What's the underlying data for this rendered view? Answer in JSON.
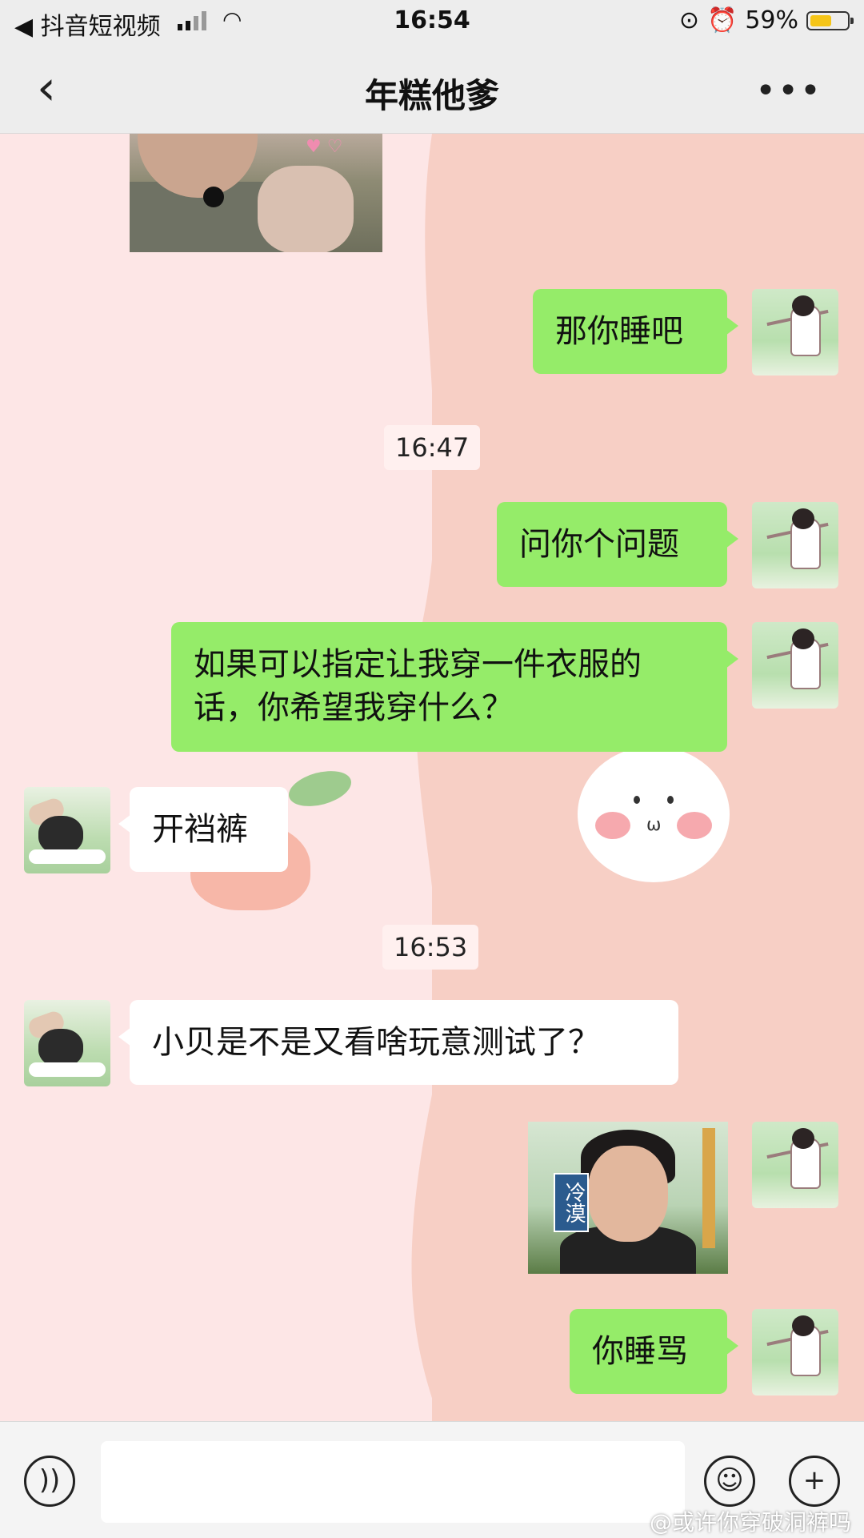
{
  "status_bar": {
    "back_app": "◀ 抖音短视频",
    "time": "16:54",
    "battery_text": "59%",
    "battery_level": 0.59
  },
  "header": {
    "back_glyph": "‹",
    "title": "年糕他爹",
    "more_glyph": "•••"
  },
  "messages": [
    {
      "text": "那你睡吧"
    },
    {
      "text": "16:47"
    },
    {
      "text": "问你个问题"
    },
    {
      "text": "如果可以指定让我穿一件衣服的话，你希望我穿什么？"
    },
    {
      "text": "开裆裤"
    },
    {
      "text": "16:53"
    },
    {
      "text": "小贝是不是又看啥玩意测试了？"
    },
    {
      "text": "冷漠"
    },
    {
      "text": "你睡骂"
    }
  ],
  "input": {
    "voice_icon": "voice-icon",
    "emoji_icon": "emoji-icon",
    "plus_icon": "plus-icon"
  },
  "watermark": "@或许你穿破洞裤吗",
  "colors": {
    "my_bubble": "#95ec69",
    "their_bubble": "#ffffff",
    "bar_bg": "#ededed"
  }
}
